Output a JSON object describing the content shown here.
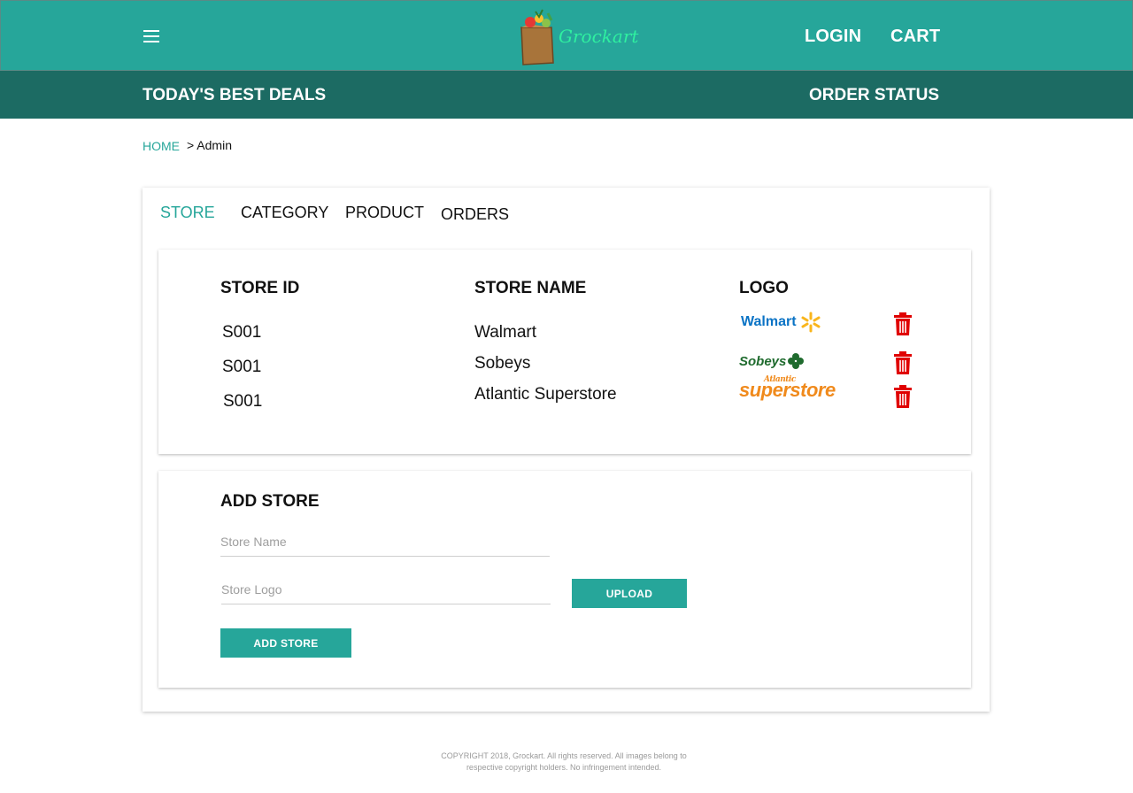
{
  "header": {
    "brand": "Grockart",
    "login_label": "LOGIN",
    "cart_label": "CART",
    "menu_icon": "hamburger-icon",
    "brand_color": "#26a69a"
  },
  "subnav": {
    "deals_label": "TODAY'S BEST DEALS",
    "order_status_label": "ORDER STATUS"
  },
  "breadcrumb": {
    "home": "HOME",
    "current": "> Admin"
  },
  "tabs": [
    {
      "label": "STORE",
      "active": true
    },
    {
      "label": "CATEGORY",
      "active": false
    },
    {
      "label": "PRODUCT",
      "active": false
    },
    {
      "label": "ORDERS",
      "active": false
    }
  ],
  "store_table": {
    "headers": [
      "STORE ID",
      "STORE NAME",
      "LOGO"
    ],
    "rows": [
      {
        "id": "S001",
        "name": "Walmart",
        "logo": "Walmart"
      },
      {
        "id": "S001",
        "name": "Sobeys",
        "logo": "Sobeys"
      },
      {
        "id": "S001",
        "name": "Atlantic Superstore",
        "logo": "superstore",
        "logo_tag": "Atlantic"
      }
    ],
    "delete_icon": "trash-icon"
  },
  "add_store": {
    "title": "ADD STORE",
    "store_name_placeholder": "Store Name",
    "store_logo_placeholder": "Store Logo",
    "upload_label": "UPLOAD",
    "add_label": "ADD STORE"
  },
  "footer": {
    "text": "COPYRIGHT 2018, Grockart. All rights reserved. All images belong to respective copyright holders. No infringement intended."
  }
}
